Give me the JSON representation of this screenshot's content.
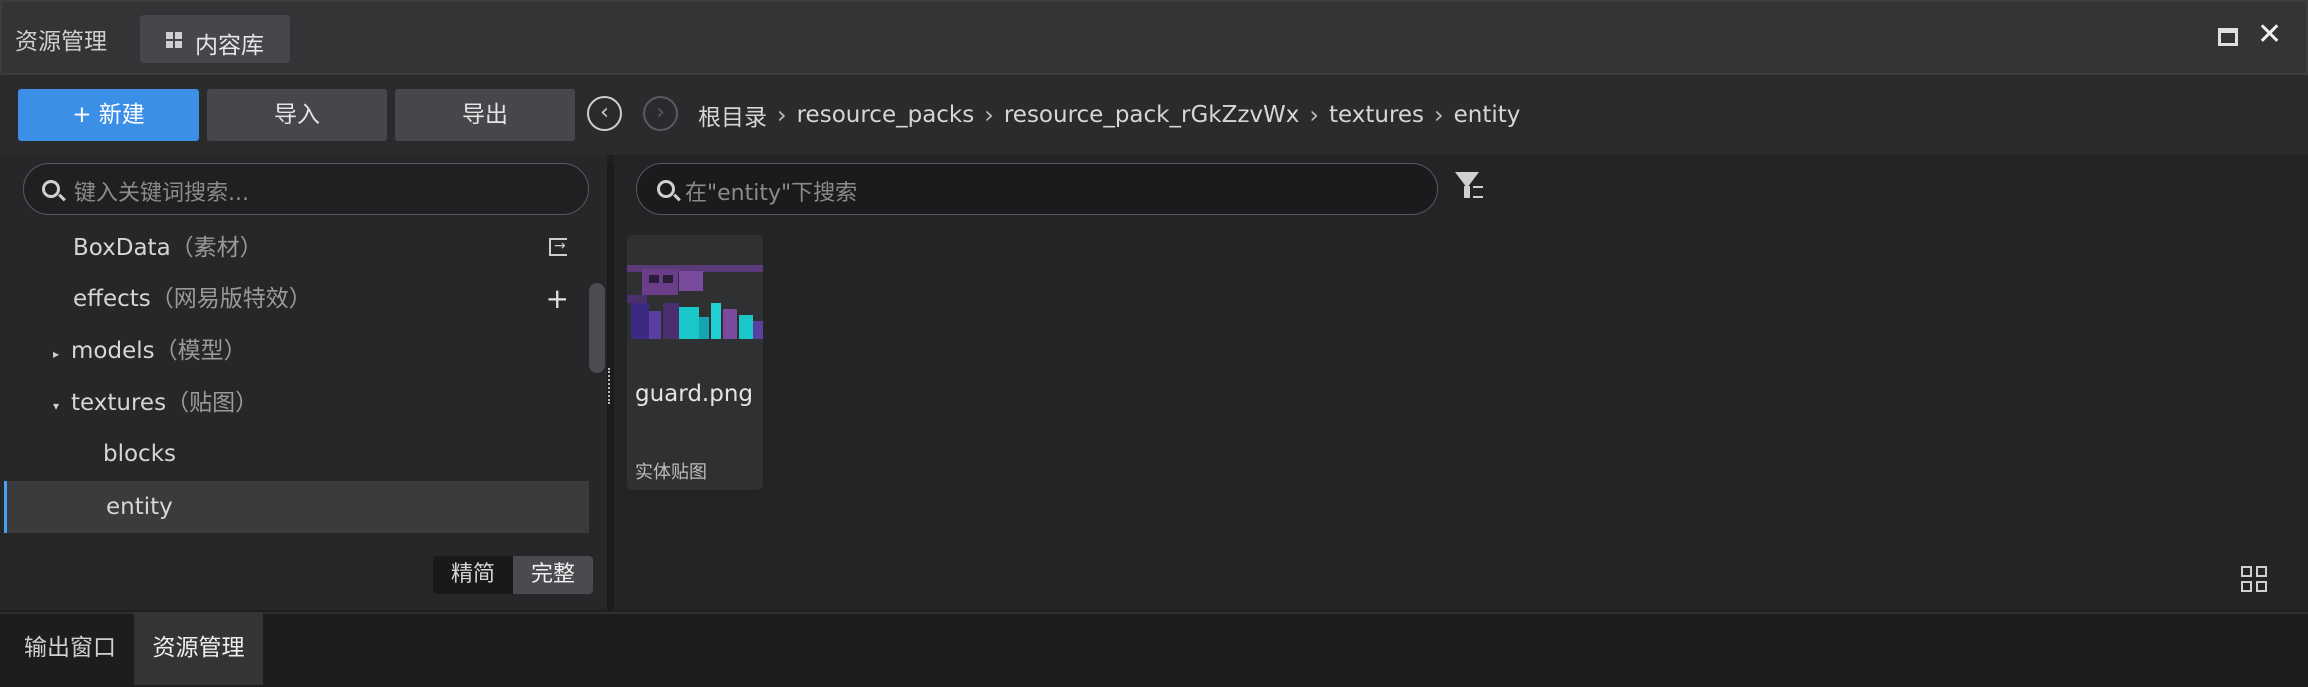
{
  "window": {
    "title": "资源管理",
    "tab_label": "内容库"
  },
  "toolbar": {
    "new_label": "+ 新建",
    "import_label": "导入",
    "export_label": "导出",
    "back_icon": "chevron-left-circle-icon",
    "forward_icon": "chevron-right-circle-icon"
  },
  "breadcrumb": {
    "items": [
      "根目录",
      "resource_packs",
      "resource_pack_rGkZzvWx",
      "textures",
      "entity"
    ]
  },
  "tree": {
    "search_placeholder": "键入关键词搜索...",
    "items": [
      {
        "label": "BoxData",
        "sub": "（素材）"
      },
      {
        "label": "effects",
        "sub": "（网易版特效）"
      },
      {
        "label": "models",
        "sub": "（模型）",
        "arrow": "▸"
      },
      {
        "label": "textures",
        "sub": "（贴图）",
        "arrow": "▾"
      },
      {
        "label": "blocks",
        "sub": ""
      },
      {
        "label": "entity",
        "sub": "",
        "selected": true
      }
    ],
    "mode_simple": "精简",
    "mode_full": "完整"
  },
  "files": {
    "search_placeholder": "在\"entity\"下搜索",
    "items": [
      {
        "name": "guard.png",
        "type": "实体贴图"
      }
    ]
  },
  "bottom_tabs": {
    "output": "输出窗口",
    "assets": "资源管理"
  },
  "colors": {
    "accent": "#3b8fe6",
    "selection_border": "#4aa0f0"
  }
}
